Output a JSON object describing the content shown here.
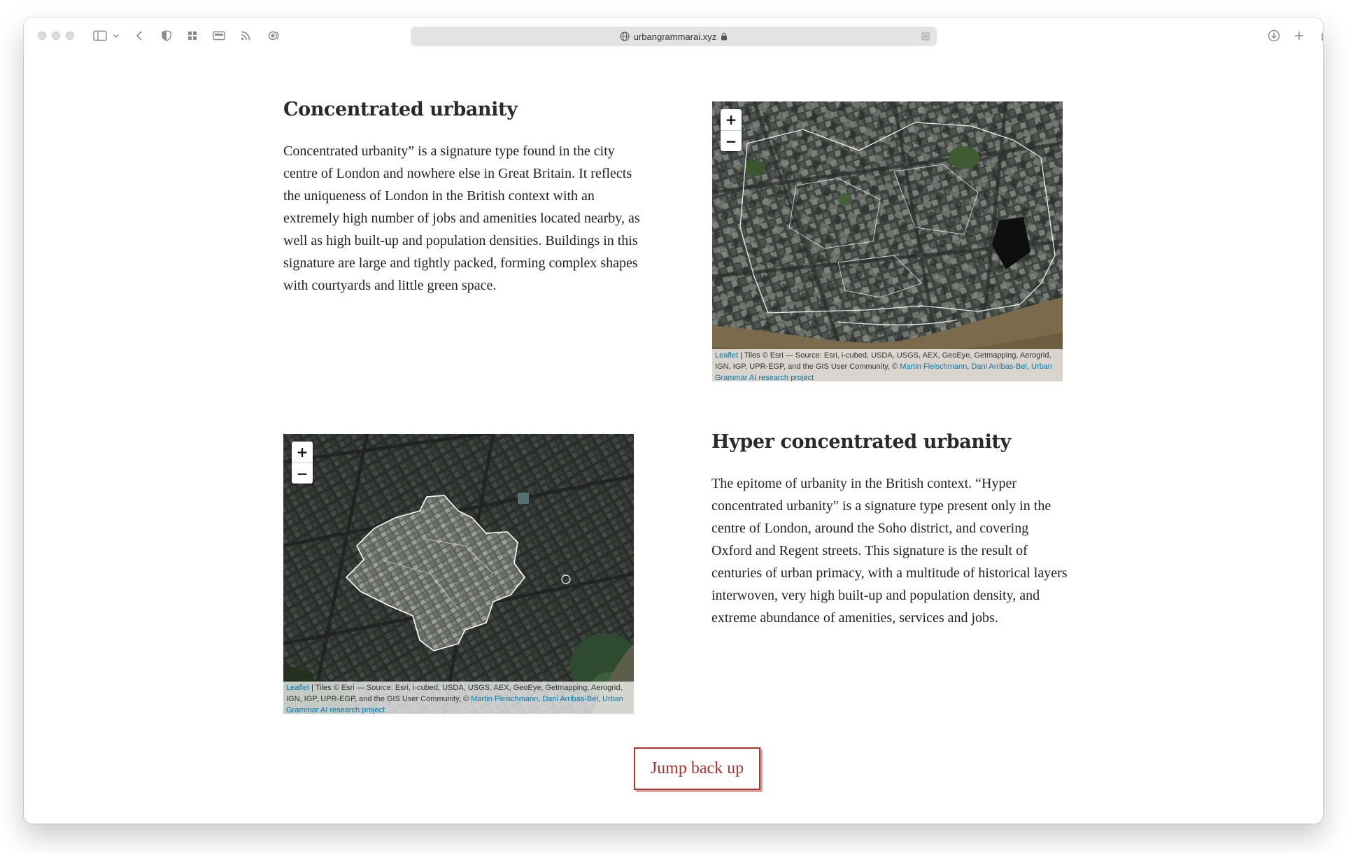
{
  "browser": {
    "url": "urbangrammarai.xyz",
    "icons": [
      "sidebar-icon",
      "chevron-down-icon",
      "back-icon",
      "shield-icon",
      "grid-icon",
      "wallet-icon",
      "rss-icon",
      "broadcast-icon",
      "download-icon",
      "plus-icon",
      "tabs-icon"
    ]
  },
  "sections": [
    {
      "title": "Concentrated urbanity",
      "text": "Concentrated urbanity” is a signature type found in the city centre of London and nowhere else in Great Britain. It reflects the uniqueness of London in the British context with an extremely high number of jobs and amenities located nearby, as well as high built-up and population densities. Buildings in this signature are large and tightly packed, forming complex shapes with courtyards and little green space."
    },
    {
      "title": "Hyper concentrated urbanity",
      "text": "The epitome of urbanity in the British context. “Hyper concentrated urbanity\" is a signature type present only in the centre of London, around the Soho district, and covering Oxford and Regent streets. This signature is the result of centuries of urban primacy, with a multitude of historical layers interwoven, very high built-up and population density, and extreme abundance of amenities, services and jobs."
    }
  ],
  "map": {
    "zoom_in": "+",
    "zoom_out": "−",
    "attribution": {
      "leaflet": "Leaflet",
      "separator": " | ",
      "tiles": "Tiles © Esri — Source: Esri, i-cubed, USDA, USGS, AEX, GeoEye, Getmapping, Aerogrid, IGN, IGP, UPR-EGP, and the GIS User Community, © ",
      "author1": "Martin Fleischmann",
      "comma": ", ",
      "author2": "Dani Arribas-Bel",
      "project": "Urban Grammar AI research project"
    }
  },
  "jump_button": "Jump back up"
}
